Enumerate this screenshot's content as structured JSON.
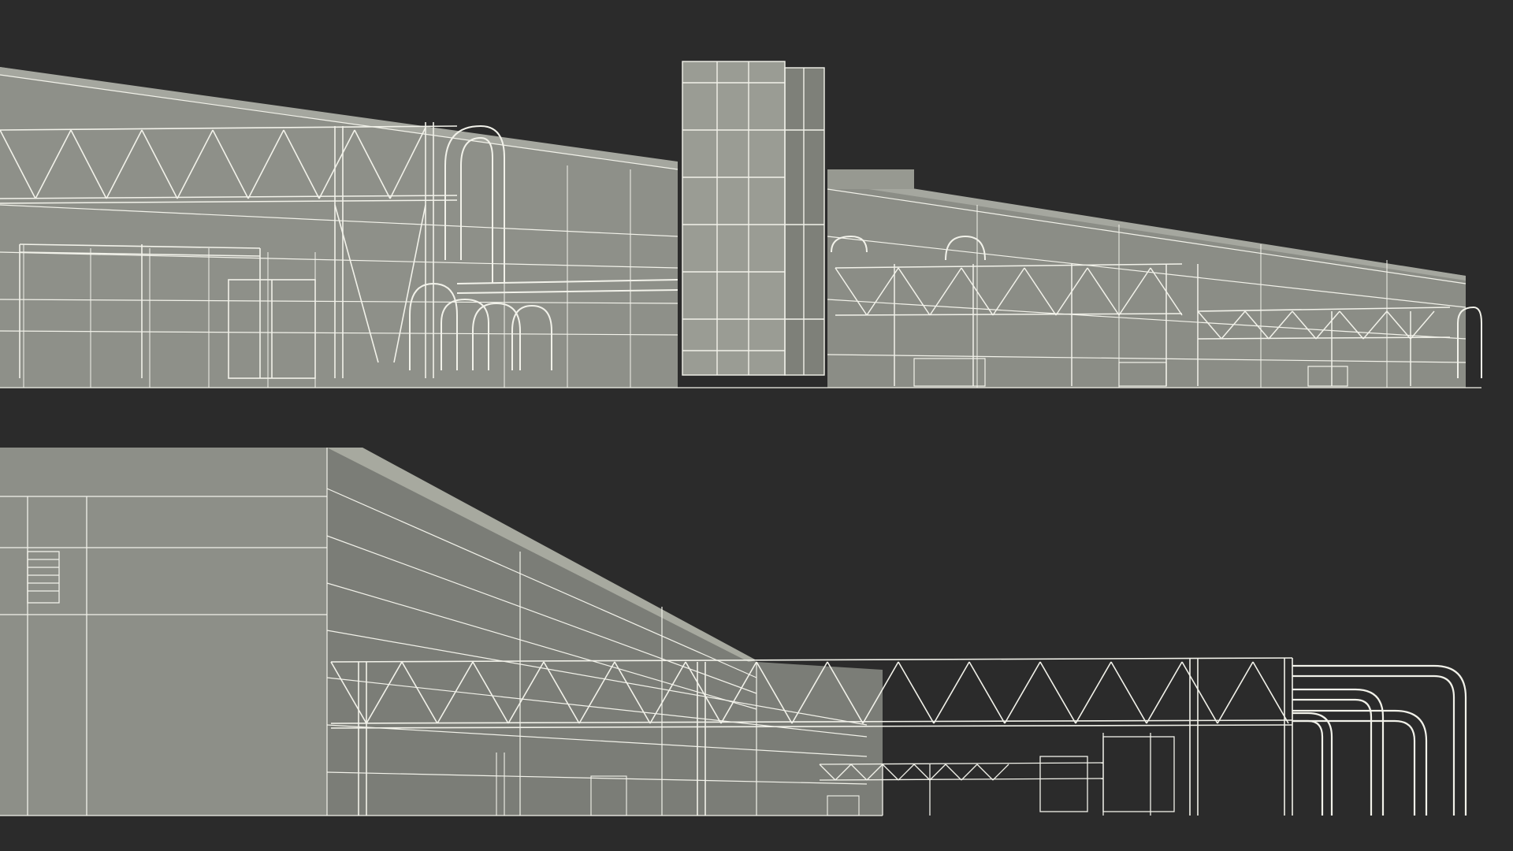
{
  "scene": {
    "background_color": "#2b2b2b",
    "model_surface_color": "#8f918a",
    "model_shadow_color": "#6f716b",
    "wireframe_color": "#f2f2ea",
    "views": [
      {
        "view": "top",
        "content": "wireframe-render-industrial-building-side"
      },
      {
        "view": "bottom",
        "content": "wireframe-render-industrial-building-perspective"
      }
    ]
  }
}
